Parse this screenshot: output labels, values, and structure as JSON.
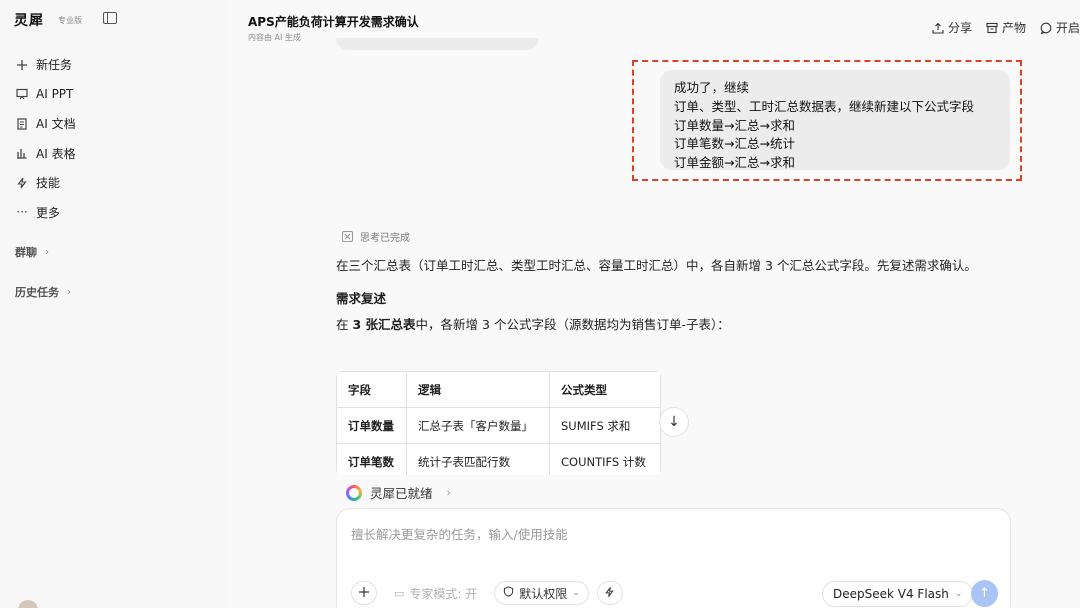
{
  "sidebar": {
    "brand": "灵犀",
    "badge": "专业版",
    "items": [
      {
        "label": "新任务",
        "icon": "plus-icon"
      },
      {
        "label": "AI PPT",
        "icon": "presentation-icon"
      },
      {
        "label": "AI 文档",
        "icon": "document-icon"
      },
      {
        "label": "AI 表格",
        "icon": "chart-icon"
      },
      {
        "label": "技能",
        "icon": "lightning-icon"
      },
      {
        "label": "更多",
        "icon": "more-icon"
      }
    ],
    "sections": [
      {
        "label": "群聊"
      },
      {
        "label": "历史任务"
      }
    ]
  },
  "header": {
    "title": "APS产能负荷计算开发需求确认",
    "subtitle": "内容由 AI 生成",
    "actions": [
      {
        "label": "分享",
        "icon": "share-icon"
      },
      {
        "label": "产物",
        "icon": "archive-icon"
      },
      {
        "label": "开启",
        "icon": "chat-bubble-icon"
      }
    ]
  },
  "conversation": {
    "user_message": [
      "成功了，继续",
      "订单、类型、工时汇总数据表，继续新建以下公式字段",
      "订单数量→汇总→求和",
      "订单笔数→汇总→统计",
      "订单金额→汇总→求和"
    ],
    "thinking_status": "思考已完成",
    "answer_intro": "在三个汇总表（订单工时汇总、类型工时汇总、容量工时汇总）中，各自新增 3 个汇总公式字段。先复述需求确认。",
    "answer_heading": "需求复述",
    "answer_line_prefix": "在 ",
    "answer_line_bold": "3 张汇总表",
    "answer_line_suffix": "中，各新增 3 个公式字段（源数据均为销售订单-子表）：",
    "table": {
      "headers": [
        "字段",
        "逻辑",
        "公式类型"
      ],
      "rows": [
        [
          "订单数量",
          "汇总子表「客户数量」",
          "SUMIFS 求和"
        ],
        [
          "订单笔数",
          "统计子表匹配行数",
          "COUNTIFS 计数"
        ]
      ]
    }
  },
  "status": {
    "ready_label": "灵犀已就绪"
  },
  "composer": {
    "placeholder": "擅长解决更复杂的任务，输入/使用技能",
    "expert_mode": "专家模式: 开",
    "permission": "默认权限",
    "model": "DeepSeek V4 Flash"
  }
}
